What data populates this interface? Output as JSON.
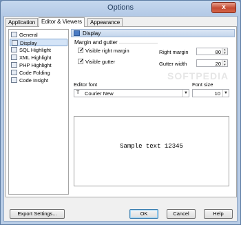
{
  "window": {
    "title": "Options",
    "close_glyph": "x"
  },
  "tabs": [
    {
      "label": "Application"
    },
    {
      "label": "Editor & Viewers"
    },
    {
      "label": "Appearance"
    }
  ],
  "sidebar": {
    "items": [
      {
        "label": "General",
        "icon": "settings-icon"
      },
      {
        "label": "Display",
        "icon": "monitor-icon"
      },
      {
        "label": "SQL Highlight",
        "icon": "highlight-icon"
      },
      {
        "label": "XML Highlight",
        "icon": "highlight-icon"
      },
      {
        "label": "PHP Highlight",
        "icon": "highlight-icon"
      },
      {
        "label": "Code Folding",
        "icon": "code-folding-icon"
      },
      {
        "label": "Code Insight",
        "icon": "code-insight-icon"
      }
    ],
    "selected": "Display"
  },
  "section": {
    "title": "Display",
    "icon": "monitor-icon"
  },
  "margin_group": {
    "title": "Margin and gutter",
    "visible_right_margin": {
      "label": "Visible right margin",
      "checked": true
    },
    "visible_gutter": {
      "label": "Visible gutter",
      "checked": true
    },
    "right_margin": {
      "label": "Right margin",
      "value": "80"
    },
    "gutter_width": {
      "label": "Gutter width",
      "value": "20"
    }
  },
  "editor_font": {
    "label": "Editor font",
    "value": "Courier New",
    "icon": "font-icon"
  },
  "font_size": {
    "label": "Font size",
    "value": "10"
  },
  "sample": {
    "text": "Sample text 12345"
  },
  "watermark": "SOFTPEDIA",
  "buttons": {
    "export": "Export Settings...",
    "ok": "OK",
    "cancel": "Cancel",
    "help": "Help"
  },
  "glyphs": {
    "check": "✓",
    "spin_up": "▲",
    "spin_down": "▼",
    "dropdown": "▼"
  }
}
